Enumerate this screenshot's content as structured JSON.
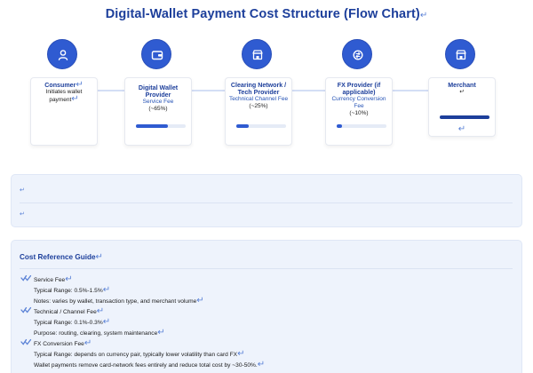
{
  "title": "Digital-Wallet Payment Cost Structure (Flow Chart)",
  "return_mark": "↵",
  "steps": [
    {
      "icon": "user-icon",
      "name": "Consumer",
      "desc": [
        "Initiates wallet",
        "payment"
      ],
      "has_bar": false
    },
    {
      "icon": "wallet-icon",
      "name": "Digital Wallet Provider",
      "desc": [
        "Service Fee",
        "(~65%)"
      ],
      "share": 0.65,
      "has_bar": true
    },
    {
      "icon": "store-icon",
      "name": "Clearing Network / Tech Provider",
      "desc": [
        "Technical Channel Fee",
        "(~25%)"
      ],
      "share": 0.25,
      "has_bar": true
    },
    {
      "icon": "exchange-icon",
      "name": "FX Provider (if applicable)",
      "desc": [
        "Currency Conversion Fee",
        "(~10%)"
      ],
      "share": 0.1,
      "has_bar": true
    },
    {
      "icon": "store-icon",
      "name": "Merchant",
      "desc": [],
      "share": 1.0,
      "has_bar": true
    }
  ],
  "guide": {
    "title": "Cost Reference Guide",
    "items": [
      {
        "head": "Service Fee",
        "lines": [
          "Typical Range: 0.5%-1.5%",
          "Notes: varies by wallet, transaction type, and merchant volume"
        ]
      },
      {
        "head": "Technical / Channel Fee",
        "lines": [
          "Typical Range: 0.1%-0.3%",
          "Purpose: routing, clearing, system maintenance"
        ]
      },
      {
        "head": "FX Conversion Fee",
        "lines": [
          "Typical Range: depends on currency pair, typically lower volatility than card FX",
          "Wallet payments remove card-network fees entirely and reduce total cost by ~30-50%."
        ]
      }
    ]
  },
  "colors": {
    "accent": "#2f5bd1",
    "title": "#1d3f9b",
    "panel": "#eef3fc"
  }
}
